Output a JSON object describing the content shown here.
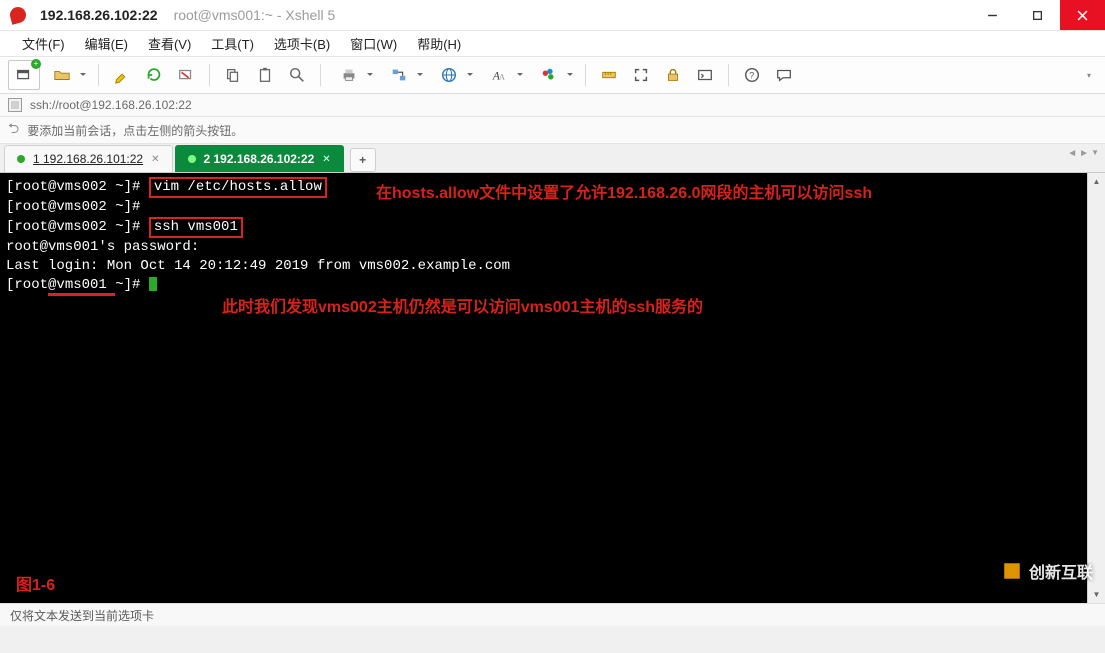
{
  "window": {
    "title_main": "192.168.26.102:22",
    "title_sub": "root@vms001:~ - Xshell 5"
  },
  "menu": {
    "file": "文件(F)",
    "edit": "编辑(E)",
    "view": "查看(V)",
    "tools": "工具(T)",
    "tabs": "选项卡(B)",
    "window": "窗口(W)",
    "help": "帮助(H)"
  },
  "toolbar_icons": {
    "new": "new-session-icon",
    "open": "open-folder-icon",
    "props": "session-props-icon",
    "highlight": "highlighter-icon",
    "reconnect": "reconnect-icon",
    "disconnect": "disconnect-icon",
    "copy": "copy-icon",
    "paste": "paste-icon",
    "find": "magnifier-icon",
    "print": "printer-icon",
    "transfer": "transfer-icon",
    "globe": "globe-icon",
    "font": "font-icon",
    "palette": "palette-icon",
    "ruler": "ruler-icon",
    "fullscreen": "fullscreen-icon",
    "lock": "lock-icon",
    "terminal": "terminal-icon",
    "help": "help-icon",
    "chat": "chat-icon"
  },
  "address": {
    "url": "ssh://root@192.168.26.102:22"
  },
  "hint": {
    "text": "要添加当前会话，点击左侧的箭头按钮。"
  },
  "tabs": {
    "items": [
      {
        "label": "1 192.168.26.101:22",
        "active": false
      },
      {
        "label": "2 192.168.26.102:22",
        "active": true
      }
    ],
    "add": "+"
  },
  "terminal": {
    "lines": {
      "p1_prefix": "[root@vms002 ~]# ",
      "p1_cmd": "vim /etc/hosts.allow",
      "p2": "[root@vms002 ~]#",
      "p3_prefix": "[root@vms002 ~]# ",
      "p3_cmd": "ssh vms001",
      "p4": "root@vms001's password:",
      "p5": "Last login: Mon Oct 14 20:12:49 2019 from vms002.example.com",
      "p6_open": "[root",
      "p6_mid": "@vms001 ",
      "p6_close": "~]# "
    },
    "annotations": {
      "a1": "在hosts.allow文件中设置了允许192.168.26.0网段的主机可以访问ssh",
      "a2": "此时我们发现vms002主机仍然是可以访问vms001主机的ssh服务的",
      "fig": "图1-6"
    }
  },
  "status": {
    "text": "仅将文本发送到当前选项卡"
  },
  "watermark": {
    "text": "创新互联"
  },
  "colors": {
    "accent_red": "#d9251d",
    "term_green": "#2aa82a",
    "tab_active": "#0b8a3e"
  }
}
